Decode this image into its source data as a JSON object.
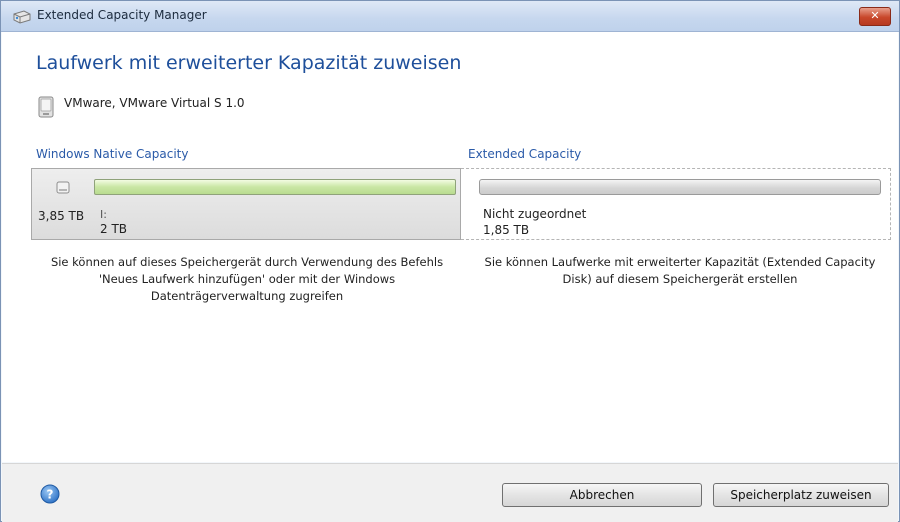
{
  "window": {
    "title": "Extended Capacity Manager",
    "close_symbol": "✕"
  },
  "main": {
    "heading": "Laufwerk mit erweiterter Kapazität zuweisen",
    "device_label": "VMware, VMware Virtual S 1.0",
    "native": {
      "column_label": "Windows Native Capacity",
      "total_capacity": "3,85 TB",
      "drive_letter": "I:",
      "partition_size": "2 TB",
      "fill_fraction": 1.0,
      "bar_color": "#c9e6a4",
      "description": "Sie können auf dieses Speichergerät durch Verwendung des Befehls 'Neues Laufwerk hinzufügen' oder mit der Windows Datenträgerverwaltung zugreifen"
    },
    "extended": {
      "column_label": "Extended Capacity",
      "unallocated_label": "Nicht zugeordnet",
      "unallocated_size": "1,85 TB",
      "bar_color": "#d6d6d6",
      "description": "Sie können Laufwerke mit erweiterter Kapazität (Extended Capacity Disk) auf diesem Speichergerät erstellen"
    }
  },
  "footer": {
    "cancel_label": "Abbrechen",
    "assign_label": "Speicherplatz zuweisen"
  },
  "icons": {
    "app": "drive-app-icon",
    "device": "hard-disk-icon",
    "help": "help-icon"
  },
  "colors": {
    "heading": "#1e4f9b",
    "column_label": "#2a5aa8",
    "close_button": "#c8472b"
  }
}
